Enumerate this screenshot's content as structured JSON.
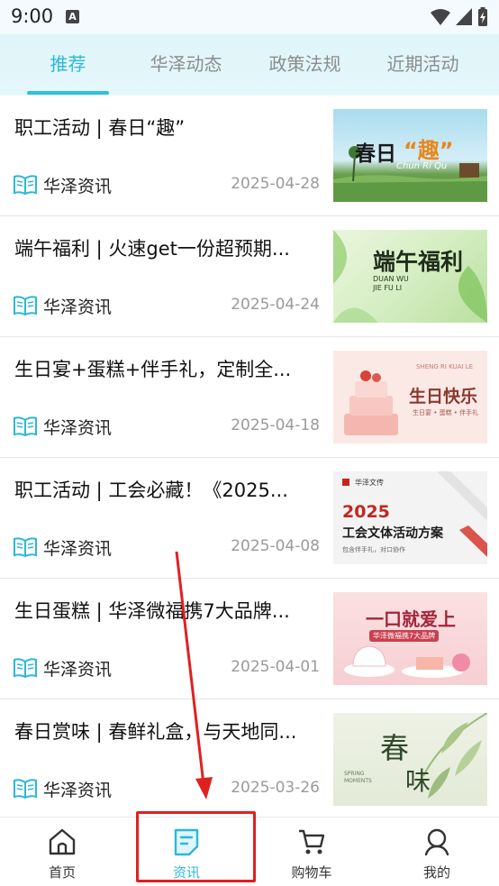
{
  "status_bar": {
    "time": "9:00",
    "notification_letter": "A"
  },
  "tabs": [
    {
      "label": "推荐",
      "active": true
    },
    {
      "label": "华泽动态",
      "active": false
    },
    {
      "label": "政策法规",
      "active": false
    },
    {
      "label": "近期活动",
      "active": false
    }
  ],
  "articles": [
    {
      "title": "职工活动 | 春日“趣”",
      "source": "华泽资讯",
      "date": "2025-04-28",
      "thumb": {
        "main_text": "春日",
        "accent_text": "“趣”",
        "sub_text": "Chun Ri Qu"
      }
    },
    {
      "title": "端午福利 | 火速get一份超预期...",
      "source": "华泽资讯",
      "date": "2025-04-24",
      "thumb": {
        "main_text": "端午福利",
        "sub_text": "DUAN WU JIE FU LI"
      }
    },
    {
      "title": "生日宴+蛋糕+伴手礼，定制全...",
      "source": "华泽资讯",
      "date": "2025-04-18",
      "thumb": {
        "main_text": "生日快乐",
        "sub_text": "SHENG RI KUAI LE",
        "tag_text": "生日宴 • 蛋糕 • 伴手礼"
      }
    },
    {
      "title": "职工活动 | 工会必藏！《2025...",
      "source": "华泽资讯",
      "date": "2025-04-08",
      "thumb": {
        "brand_text": "华泽文传",
        "year_text": "2025",
        "main_text": "工会文体活动方案",
        "sub_text": "包含伴手礼，对口协作"
      }
    },
    {
      "title": "生日蛋糕 | 华泽微福携7大品牌...",
      "source": "华泽资讯",
      "date": "2025-04-01",
      "thumb": {
        "main_text": "一口就爱上",
        "sub_text": "华泽微福携7大品牌"
      }
    },
    {
      "title": "春日赏味 | 春鲜礼盒，与天地同...",
      "source": "华泽资讯",
      "date": "2025-03-26",
      "thumb": {
        "main_text": "春",
        "main_text_2": "味",
        "sub_text": "SPRING MOMENTS"
      }
    }
  ],
  "bottom_nav": [
    {
      "label": "首页",
      "icon": "home-icon",
      "active": false
    },
    {
      "label": "资讯",
      "icon": "news-icon",
      "active": true
    },
    {
      "label": "购物车",
      "icon": "cart-icon",
      "active": false
    },
    {
      "label": "我的",
      "icon": "profile-icon",
      "active": false
    }
  ],
  "colors": {
    "accent": "#2bb8d8",
    "annotation": "#e02020"
  }
}
